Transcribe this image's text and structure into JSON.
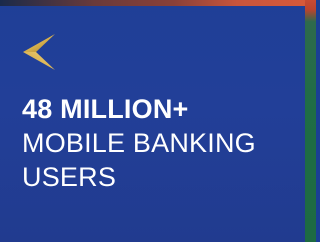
{
  "banner": {
    "headline_line1": "48 MILLION+",
    "headline_line2": "MOBILE BANKING",
    "headline_line3": "USERS"
  },
  "colors": {
    "background": "#213f96",
    "text": "#ffffff",
    "logo_gold": "#d8b24e",
    "accent_green": "#1f6d45",
    "accent_red": "#c84b33"
  },
  "icons": {
    "logo": "chevron-arrow-logo-icon"
  }
}
